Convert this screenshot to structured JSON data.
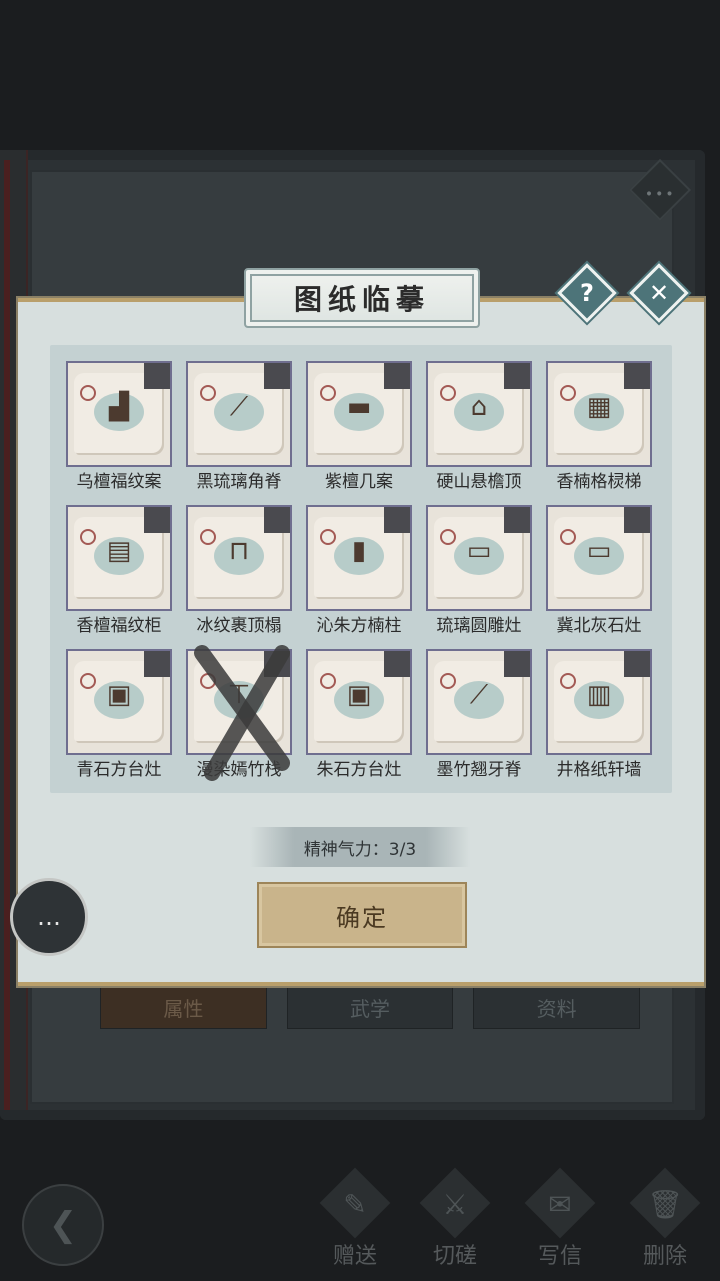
{
  "dialog": {
    "title": "图纸临摹",
    "stamina_label": "精神气力：3/3",
    "confirm_label": "确定"
  },
  "blueprints": [
    {
      "label": "乌檀福纹案",
      "icon": "desk-icon",
      "crossed": false
    },
    {
      "label": "黑琉璃角脊",
      "icon": "roof-ridge-icon",
      "crossed": false
    },
    {
      "label": "紫檀几案",
      "icon": "tea-table-icon",
      "crossed": false
    },
    {
      "label": "硬山悬檐顶",
      "icon": "pavilion-roof-icon",
      "crossed": false
    },
    {
      "label": "香楠格棂梯",
      "icon": "lattice-stair-icon",
      "crossed": false
    },
    {
      "label": "香檀福纹柜",
      "icon": "cabinet-icon",
      "crossed": false
    },
    {
      "label": "冰纹裹顶榻",
      "icon": "canopy-bed-icon",
      "crossed": false
    },
    {
      "label": "沁朱方楠柱",
      "icon": "pillar-icon",
      "crossed": false
    },
    {
      "label": "琉璃圆雕灶",
      "icon": "stove-icon",
      "crossed": false
    },
    {
      "label": "冀北灰石灶",
      "icon": "stone-stove-icon",
      "crossed": false
    },
    {
      "label": "青石方台灶",
      "icon": "square-stove-icon",
      "crossed": false
    },
    {
      "label": "漫染嫣竹栈",
      "icon": "bamboo-rack-icon",
      "crossed": true
    },
    {
      "label": "朱石方台灶",
      "icon": "square-stove-icon",
      "crossed": false
    },
    {
      "label": "墨竹翘牙脊",
      "icon": "roof-ridge-icon",
      "crossed": false
    },
    {
      "label": "井格纸轩墙",
      "icon": "lattice-wall-icon",
      "crossed": false
    }
  ],
  "background": {
    "tabs": [
      "属性",
      "武学",
      "资料"
    ],
    "actions": [
      "赠送",
      "切磋",
      "写信",
      "删除"
    ]
  }
}
